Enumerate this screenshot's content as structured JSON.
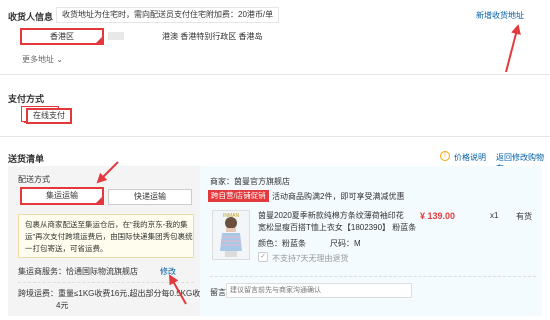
{
  "consignee": {
    "title": "收货人信息",
    "tip": "收货地址为住宅时，需向配送员支付住宅附加费：20港币/单",
    "add_link": "新增收货地址",
    "address_tag": "香港区",
    "address_text": "港澳 香港特别行政区 香港岛",
    "more_link": "更多地址 ",
    "more_icon": "chevron-down"
  },
  "payment": {
    "title": "支付方式",
    "method": "在线支付"
  },
  "delivery": {
    "title": "送货清单",
    "price_help": "价格说明",
    "back_cart": "返回修改购物车",
    "shipping_label": "配送方式",
    "ship_opt1": "集运运输",
    "ship_opt2": "快递运输",
    "notice": [
      "包裹从商家配送至集运仓后，在\"我的京东-我的集",
      "运\"再次支付跨境运费后，由国际快递集团秀包裹统",
      "一打包寄送，可省运费。"
    ],
    "warehouse_label": "集运商服务：恰通国际物流旗舰店",
    "modify_link": "修改",
    "fee_line1": "跨境运费：重量≤1KG收费16元,超出部分每0.5KG收费",
    "fee_line2": "4元"
  },
  "shop": {
    "label": "商家：茵曼官方旗舰店",
    "promo_tag": "跨自营/店铺促销",
    "promo_text": "活动商品购满2件，即可享受满减优惠"
  },
  "product": {
    "name_lines": [
      "茵曼2020夏季新款纯棉方条纹薄荷袖印花",
      "宽松显瘦百搭T恤上衣女【1802390】 粉蓝条"
    ],
    "price": "¥ 139.00",
    "qty": "x1",
    "stock": "有货",
    "color_label": "颜色：粉蓝条",
    "size_label": "尺码：M",
    "return_note": "不支持7天无理由退货",
    "image_caption": "INMAN"
  },
  "remark": {
    "label": "留言:",
    "placeholder": "建议留言前先与商家沟通确认"
  },
  "colors": {
    "accent": "#e4393c",
    "link": "#005ea7",
    "tag_orange": "#f1a70d"
  }
}
